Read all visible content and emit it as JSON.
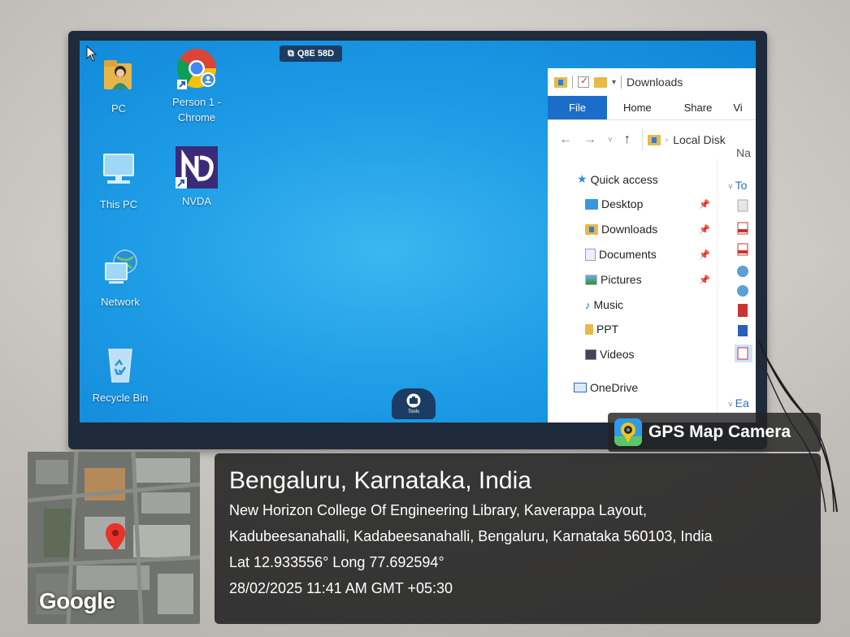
{
  "screen_badge": "Q8E 58D",
  "desktop_icons": [
    {
      "name": "pc",
      "label": "PC"
    },
    {
      "name": "chrome",
      "label_line1": "Person 1 -",
      "label_line2": "Chrome"
    },
    {
      "name": "this-pc",
      "label": "This PC"
    },
    {
      "name": "nvda",
      "label": "NVDA"
    },
    {
      "name": "network",
      "label": "Network"
    },
    {
      "name": "recycle-bin",
      "label": "Recycle Bin"
    }
  ],
  "tools_label": "Tools",
  "explorer": {
    "title": "Downloads",
    "ribbon_tabs": [
      "File",
      "Home",
      "Share",
      "Vi"
    ],
    "address": "Local Disk",
    "column_header": "Na",
    "group_header": "To",
    "quick_access": "Quick access",
    "items": [
      "Desktop",
      "Downloads",
      "Documents",
      "Pictures",
      "Music",
      "PPT",
      "Videos"
    ],
    "onedrive": "OneDrive",
    "bottom_group": "Ea"
  },
  "gps": {
    "app_name": "GPS Map Camera",
    "city": "Bengaluru, Karnataka, India",
    "address_line1": "New Horizon College Of Engineering Library, Kaverappa Layout,",
    "address_line2": "Kadubeesanahalli, Kadabeesanahalli, Bengaluru, Karnataka 560103, India",
    "coords": "Lat 12.933556° Long 77.692594°",
    "datetime": "28/02/2025 11:41 AM GMT +05:30",
    "map_brand": "Google"
  },
  "colors": {
    "screen": "#1f9de6",
    "explorer_file_tab": "#1c6dc9",
    "bezel": "#1f2a3a",
    "folder": "#e8b84a"
  }
}
